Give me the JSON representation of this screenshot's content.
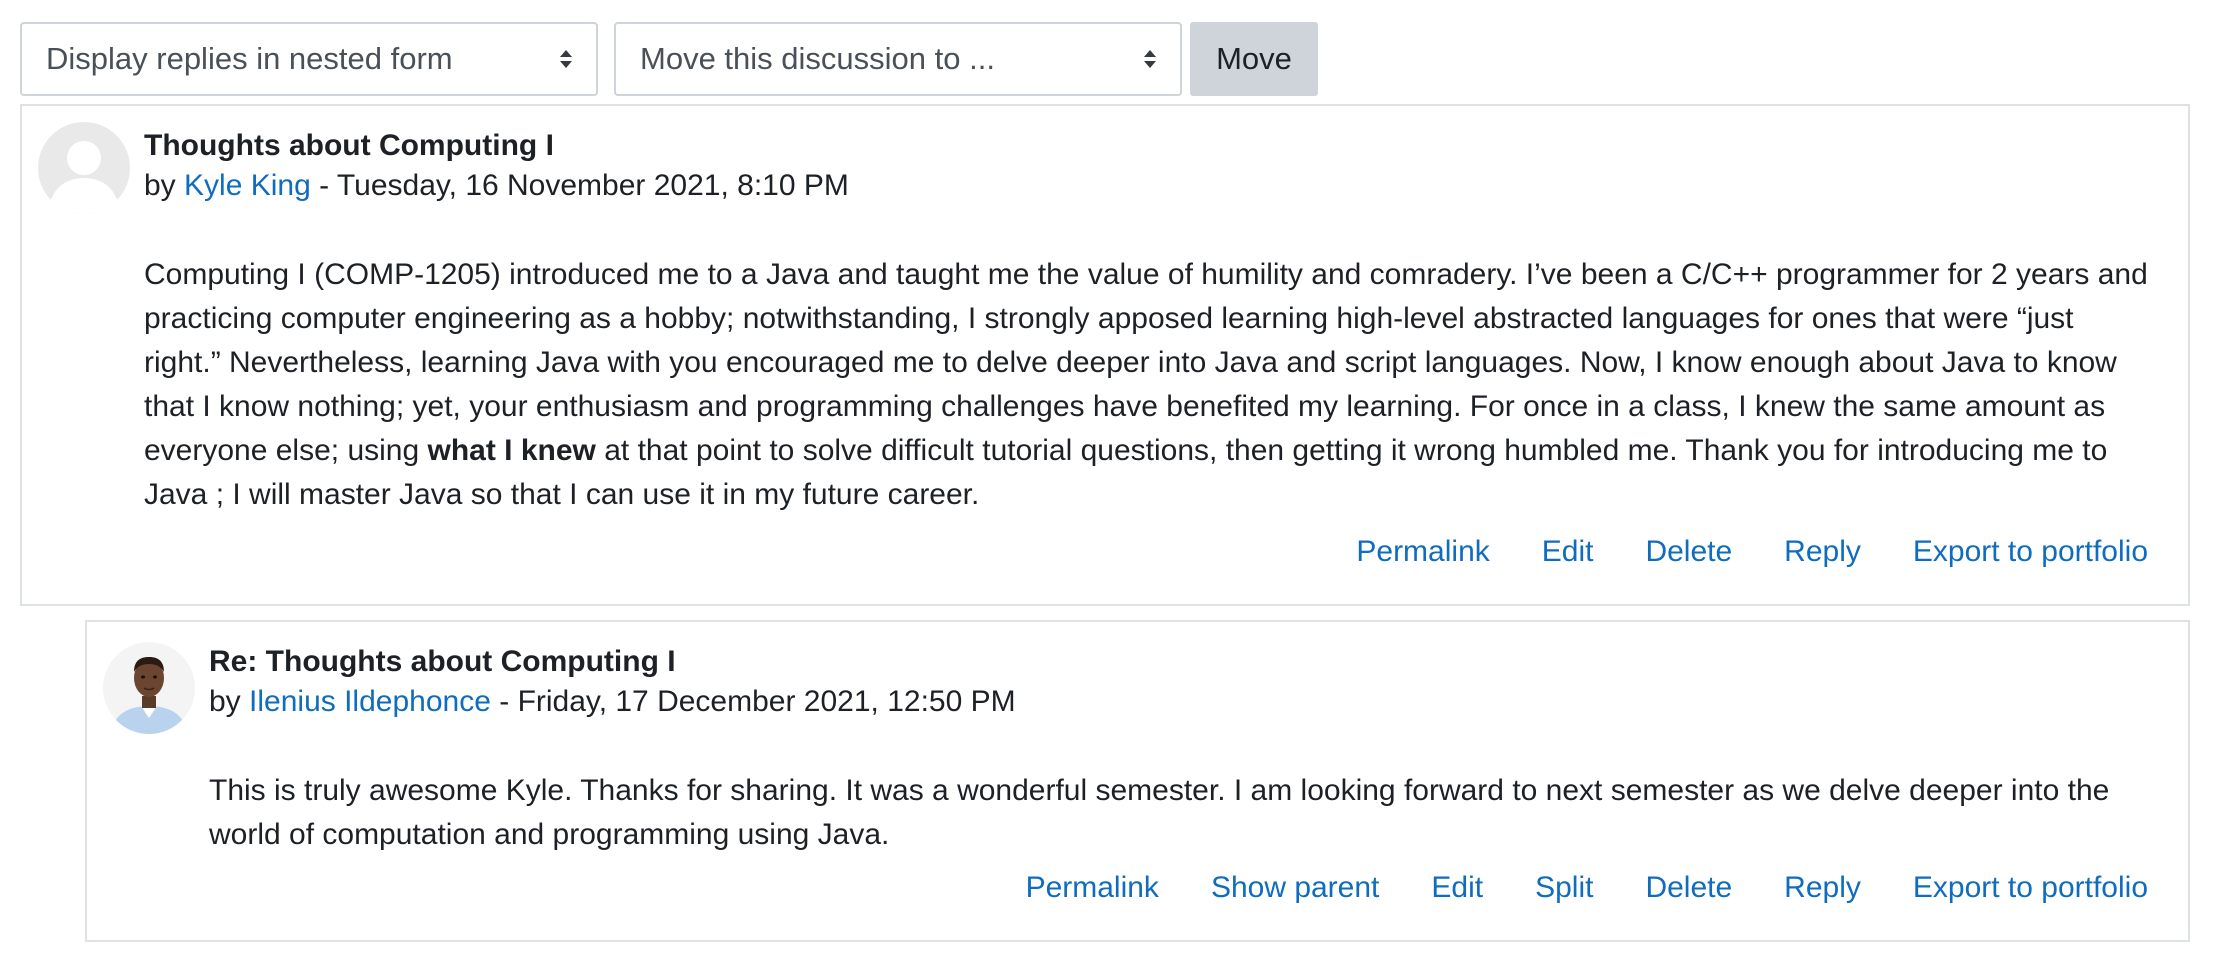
{
  "controls": {
    "display_mode_selected": "Display replies in nested form",
    "move_target_selected": "Move this discussion to ...",
    "move_button_label": "Move"
  },
  "posts": [
    {
      "subject": "Thoughts about Computing I",
      "by_prefix": "by",
      "author": "Kyle King",
      "separator": "-",
      "date": "Tuesday, 16 November 2021, 8:10 PM",
      "message_before_bold": "Computing I (COMP-1205) introduced me to a Java and taught me the value of humility and comradery. I’ve been a C/C++ programmer for 2 years and practicing computer engineering as a hobby; notwithstanding, I strongly apposed learning high-level abstracted languages for ones that were “just right.” Nevertheless, learning Java with you encouraged me to delve deeper into Java and script languages. Now, I know enough about Java to know that I know nothing; yet, your enthusiasm and programming challenges have benefited my learning. For once in a class, I knew the same amount as everyone else; using ",
      "message_bold": "what I knew",
      "message_after_bold": " at that point to solve difficult tutorial questions, then getting it wrong humbled me. Thank you for introducing me to Java ; I will master Java so that I can use it in my future career.",
      "commands": {
        "permalink": "Permalink",
        "edit": "Edit",
        "delete": "Delete",
        "reply": "Reply",
        "export": "Export to portfolio"
      }
    },
    {
      "subject": "Re: Thoughts about Computing I",
      "by_prefix": "by",
      "author": "Ilenius Ildephonce",
      "separator": "-",
      "date": "Friday, 17 December 2021, 12:50 PM",
      "message": "This is truly awesome Kyle. Thanks for sharing. It was a wonderful semester. I am looking forward to next semester as we delve deeper into the world of computation and programming using Java.",
      "commands": {
        "permalink": "Permalink",
        "show_parent": "Show parent",
        "edit": "Edit",
        "split": "Split",
        "delete": "Delete",
        "reply": "Reply",
        "export": "Export to portfolio"
      }
    }
  ],
  "colors": {
    "link": "#0f6cbf",
    "text": "#1d2125",
    "border": "#dee2e6",
    "button_bg": "#ced4da"
  },
  "icons": {
    "select_arrows": "select-arrows-icon",
    "default_avatar": "default-user-icon"
  }
}
